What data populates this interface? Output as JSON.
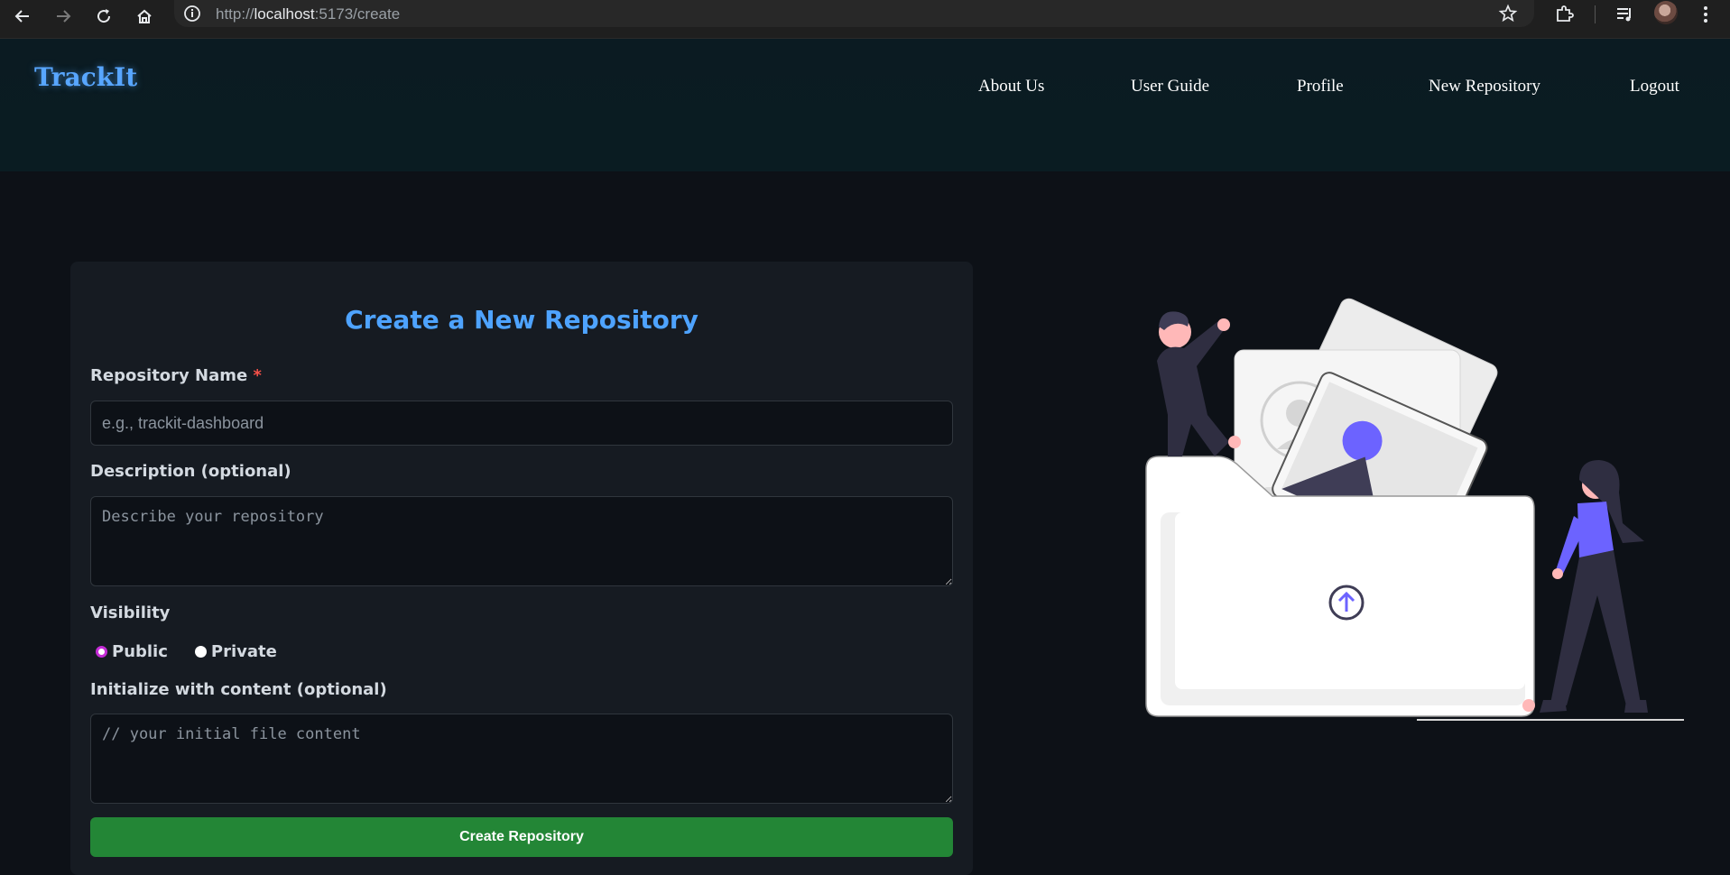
{
  "browser": {
    "url_scheme": "http://",
    "url_host": "localhost",
    "url_path": ":5173/create"
  },
  "header": {
    "brand": "TrackIt",
    "nav": [
      "About Us",
      "User Guide",
      "Profile",
      "New Repository",
      "Logout"
    ]
  },
  "form": {
    "title": "Create a New Repository",
    "name_label": "Repository Name",
    "required_mark": "*",
    "name_placeholder": "e.g., trackit-dashboard",
    "description_label": "Description (optional)",
    "description_placeholder": "Describe your repository",
    "visibility_label": "Visibility",
    "visibility_options": [
      "Public",
      "Private"
    ],
    "visibility_selected": "Public",
    "content_label": "Initialize with content (optional)",
    "content_placeholder": "// your initial file content",
    "submit_label": "Create Repository"
  },
  "colors": {
    "accent": "#4ea3ff",
    "submit": "#238636",
    "illustration_accent": "#6c63ff"
  },
  "icons": [
    "back-icon",
    "forward-icon",
    "reload-icon",
    "home-icon",
    "site-info-icon",
    "bookmark-star-icon",
    "extensions-icon",
    "reading-list-icon",
    "profile-avatar",
    "menu-kebab-icon",
    "upload-arrow-icon"
  ]
}
